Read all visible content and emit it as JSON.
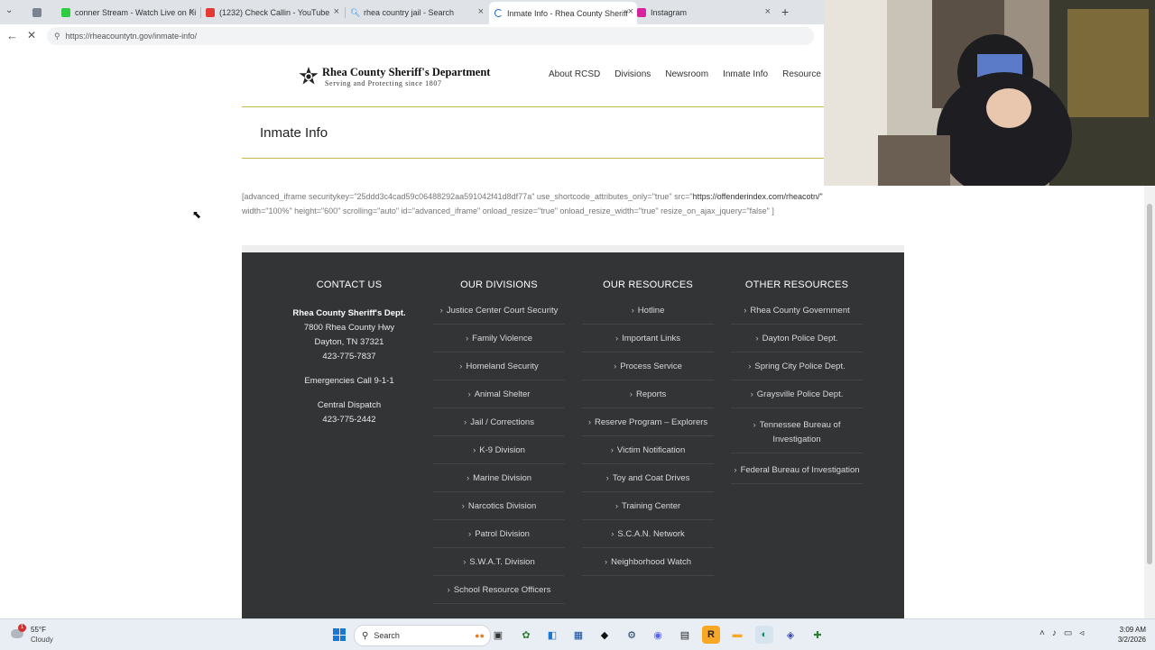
{
  "browser": {
    "tabs": [
      {
        "label": "conner Stream - Watch Live on Ki",
        "favicon": "kick-icon",
        "color": "#2ecc40"
      },
      {
        "label": "(1232) Check Callin - YouTube",
        "favicon": "youtube-icon",
        "color": "#e53935"
      },
      {
        "label": "rhea country jail - Search",
        "favicon": "search-icon",
        "color": "#1e88e5"
      },
      {
        "label": "Inmate Info - Rhea County Sheriff",
        "favicon": "loading-icon",
        "color": "#1565c0"
      },
      {
        "label": "Instagram",
        "favicon": "instagram-icon",
        "color": "#d6249f"
      }
    ],
    "active_tab_index": 3,
    "url": "https://rheacountytn.gov/inmate-info/"
  },
  "site": {
    "logo_title": "Rhea County Sheriff's Department",
    "logo_subtitle": "Serving and Protecting since 1807",
    "nav": [
      "About RCSD",
      "Divisions",
      "Newsroom",
      "Inmate Info",
      "Resource"
    ],
    "page_title": "Inmate Info",
    "shortcode_line1_a": "[advanced_iframe securitykey=\"25ddd3c4cad59c06488292aa591042f41d8df77a\" use_shortcode_attributes_only=\"true\" src=\"",
    "shortcode_line1_b": "https://offenderindex.com/rheacotn/\"",
    "shortcode_line2": "width=\"100%\" height=\"600\" scrolling=\"auto\" id=\"advanced_iframe\" onload_resize=\"true\" onload_resize_width=\"true\" resize_on_ajax_jquery=\"false\" ]"
  },
  "footer": {
    "contact": {
      "heading": "CONTACT US",
      "name": "Rhea County Sheriff's Dept.",
      "address1": "7800 Rhea County Hwy",
      "address2": "Dayton, TN 37321",
      "phone": "423-775-7837",
      "emergency": "Emergencies Call 9-1-1",
      "dispatch_label": "Central Dispatch",
      "dispatch_phone": "423-775-2442"
    },
    "divisions": {
      "heading": "OUR DIVISIONS",
      "items": [
        "Justice Center Court Security",
        "Family Violence",
        "Homeland Security",
        "Animal Shelter",
        "Jail / Corrections",
        "K-9 Division",
        "Marine Division",
        "Narcotics Division",
        "Patrol Division",
        "S.W.A.T. Division",
        "School Resource Officers"
      ]
    },
    "resources": {
      "heading": "OUR RESOURCES",
      "items": [
        "Hotline",
        "Important Links",
        "Process Service",
        "Reports",
        "Reserve Program – Explorers",
        "Victim Notification",
        "Toy and Coat Drives",
        "Training Center",
        "S.C.A.N. Network",
        "Neighborhood Watch"
      ]
    },
    "other": {
      "heading": "OTHER RESOURCES",
      "items": [
        "Rhea County Government",
        "Dayton Police Dept.",
        "Spring City Police Dept.",
        "Graysville Police Dept.",
        "Tennessee Bureau of Investigation",
        "Federal Bureau of Investigation"
      ]
    }
  },
  "taskbar": {
    "weather_temp": "55°F",
    "weather_cond": "Cloudy",
    "notification_count": "1",
    "search_label": "Search",
    "time": "3:09 AM",
    "date": "3/2/2026"
  }
}
